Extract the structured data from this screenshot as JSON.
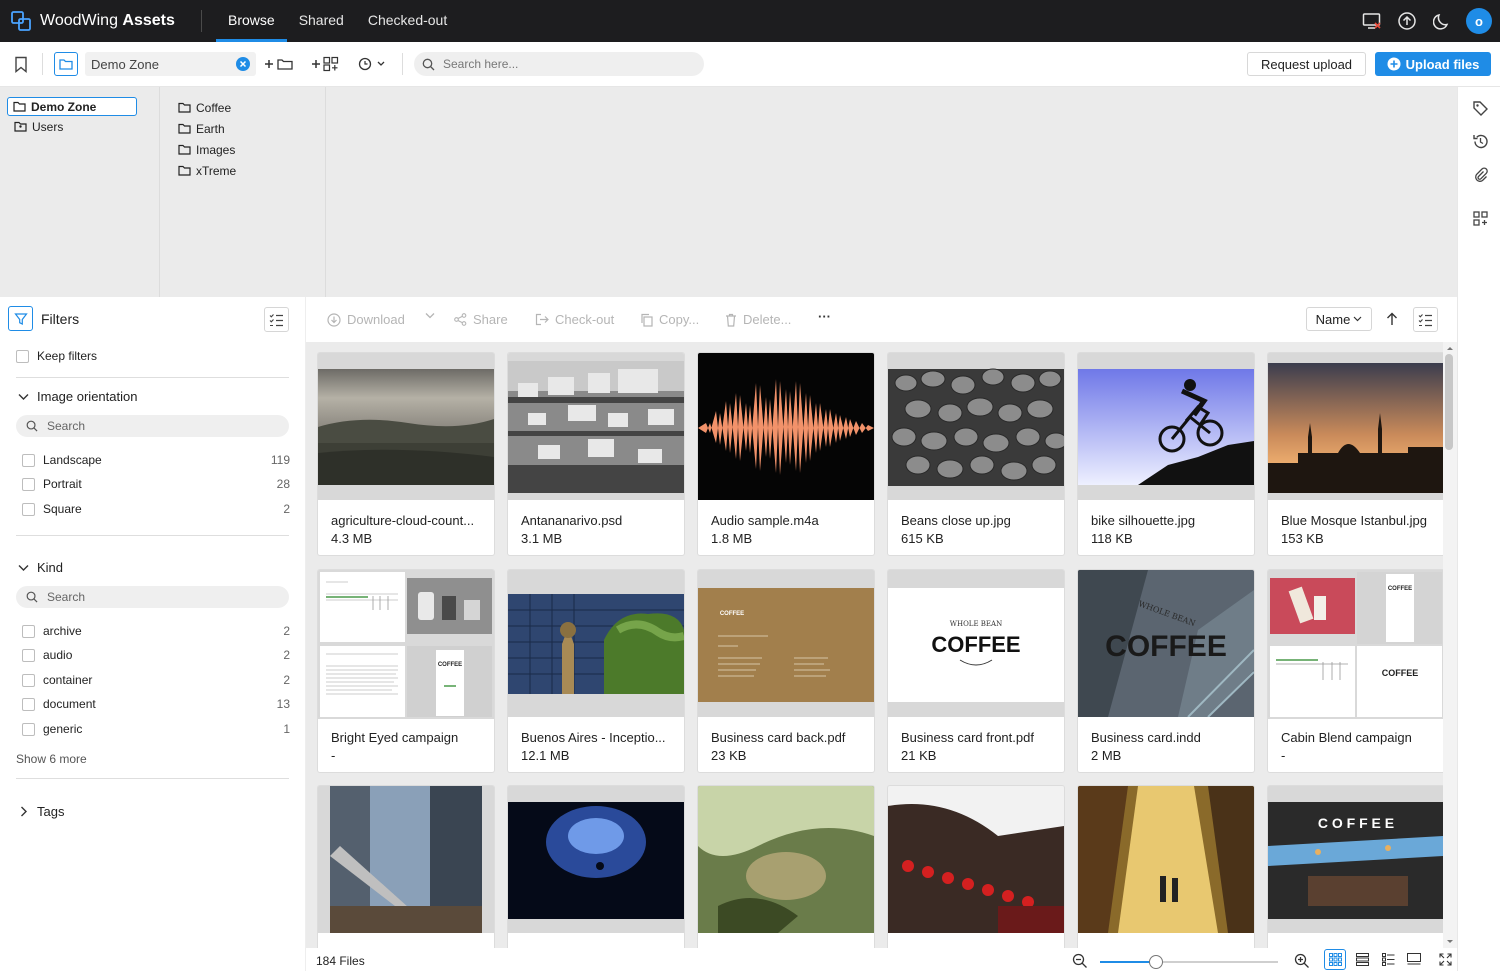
{
  "app": {
    "logo_text_light": "WoodWing",
    "logo_text_bold": "Assets",
    "nav": [
      "Browse",
      "Shared",
      "Checked-out"
    ],
    "avatar_initial": "o",
    "accent_color": "#1f8ce6"
  },
  "toolbar": {
    "zone_value": "Demo Zone",
    "search_placeholder": "Search here...",
    "request_upload": "Request upload",
    "upload_files": "Upload files"
  },
  "folders": {
    "roots": [
      "Demo Zone",
      "Users"
    ],
    "children": [
      "Coffee",
      "Earth",
      "Images",
      "xTreme"
    ]
  },
  "filters": {
    "title": "Filters",
    "keep_filters": "Keep filters",
    "orientation": {
      "title": "Image orientation",
      "search_placeholder": "Search",
      "options": [
        {
          "label": "Landscape",
          "count": "119"
        },
        {
          "label": "Portrait",
          "count": "28"
        },
        {
          "label": "Square",
          "count": "2"
        }
      ]
    },
    "kind": {
      "title": "Kind",
      "search_placeholder": "Search",
      "options": [
        {
          "label": "archive",
          "count": "2"
        },
        {
          "label": "audio",
          "count": "2"
        },
        {
          "label": "container",
          "count": "2"
        },
        {
          "label": "document",
          "count": "13"
        },
        {
          "label": "generic",
          "count": "1"
        }
      ],
      "show_more": "Show 6 more"
    },
    "tags": {
      "title": "Tags"
    }
  },
  "actions": {
    "download": "Download",
    "share": "Share",
    "checkout": "Check-out",
    "copy": "Copy...",
    "delete": "Delete...",
    "more": "···",
    "sort": "Name"
  },
  "assets": [
    {
      "name": "agriculture-cloud-count...",
      "size": "4.3 MB"
    },
    {
      "name": "Antananarivo.psd",
      "size": "3.1 MB"
    },
    {
      "name": "Audio sample.m4a",
      "size": "1.8 MB"
    },
    {
      "name": "Beans close up.jpg",
      "size": "615 KB"
    },
    {
      "name": "bike silhouette.jpg",
      "size": "118 KB"
    },
    {
      "name": "Blue Mosque Istanbul.jpg",
      "size": "153 KB"
    },
    {
      "name": "Bright Eyed campaign",
      "size": "-"
    },
    {
      "name": "Buenos Aires - Inceptio...",
      "size": "12.1 MB"
    },
    {
      "name": "Business card back.pdf",
      "size": "23 KB"
    },
    {
      "name": "Business card front.pdf",
      "size": "21 KB"
    },
    {
      "name": "Business card.indd",
      "size": "2 MB"
    },
    {
      "name": "Cabin Blend campaign",
      "size": "-"
    }
  ],
  "thumb_texts": {
    "coffee": "COFFEE",
    "coffee_spaced": "C O F F E E",
    "whole_bean": "WHOLE BEAN"
  },
  "status": {
    "file_count": "184 Files",
    "zoom_level": 0.3
  }
}
